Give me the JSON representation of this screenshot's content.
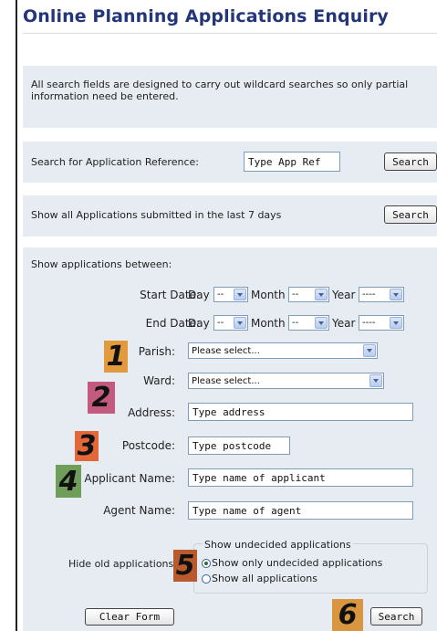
{
  "title": "Online Planning Applications Enquiry",
  "intro_text": "All search fields are designed to carry out wildcard searches so only partial information need be entered.",
  "app_ref": {
    "label": "Search for Application Reference:",
    "placeholder": "Type App Ref",
    "button": "Search"
  },
  "last7": {
    "label": "Show all Applications submitted in the last 7 days",
    "button": "Search"
  },
  "between": {
    "heading": "Show applications between:",
    "start_label": "Start Date:",
    "end_label": "End Date:",
    "day_label": "Day",
    "month_label": "Month",
    "year_label": "Year",
    "day_value": "--",
    "month_value": "--",
    "year_value": "----"
  },
  "fields": {
    "parish_label": "Parish:",
    "parish_value": "Please select...",
    "ward_label": "Ward:",
    "ward_value": "Please select...",
    "address_label": "Address:",
    "address_value": "Type address",
    "postcode_label": "Postcode:",
    "postcode_value": "Type postcode",
    "applicant_label": "Applicant Name:",
    "applicant_value": "Type name of applicant",
    "agent_label": "Agent Name:",
    "agent_value": "Type name of agent"
  },
  "undecided": {
    "hide_label": "Hide old applications",
    "legend": "Show undecided applications",
    "option1": "Show only undecided applications",
    "option2": "Show all applications",
    "selected": "Show only undecided applications"
  },
  "buttons": {
    "clear": "Clear Form",
    "search": "Search"
  },
  "annotations": {
    "n1": "1",
    "n2": "2",
    "n3": "3",
    "n4": "4",
    "n5": "5",
    "n6": "6",
    "colors": {
      "n1": "#e39a3c",
      "n2": "#c35b7e",
      "n3": "#e2683a",
      "n4": "#6f9e5a",
      "n5": "#b85a2e",
      "n6": "#d99640"
    }
  }
}
